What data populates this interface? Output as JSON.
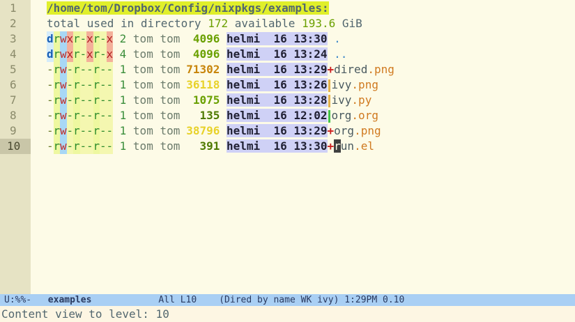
{
  "header": {
    "path": "/home/tom/Dropbox/Config/nixpkgs/examples:",
    "total_prefix": "total used in directory ",
    "total_used": "172",
    "available_label": " available ",
    "available_value": "193.6",
    "available_unit": " GiB"
  },
  "line_numbers": [
    "1",
    "2",
    "3",
    "4",
    "5",
    "6",
    "7",
    "8",
    "9",
    "10"
  ],
  "entries": [
    {
      "perms": [
        "d",
        "r",
        "w",
        "x",
        "r",
        "-",
        "x",
        "r",
        "-",
        "x"
      ],
      "links": "2",
      "owner": "tom tom",
      "size": "4096",
      "size_color": "#6aa000",
      "user": "helmi",
      "day": "16",
      "time": "13:30",
      "mark": "",
      "name": ".",
      "ext": ""
    },
    {
      "perms": [
        "d",
        "r",
        "w",
        "x",
        "r",
        "-",
        "x",
        "r",
        "-",
        "x"
      ],
      "links": "4",
      "owner": "tom tom",
      "size": "4096",
      "size_color": "#6aa000",
      "user": "helmi",
      "day": "16",
      "time": "13:24",
      "mark": "",
      "name": "..",
      "ext": ""
    },
    {
      "perms": [
        "-",
        "r",
        "w",
        "-",
        "r",
        "-",
        "-",
        "r",
        "-",
        "-"
      ],
      "links": "1",
      "owner": "tom tom",
      "size": "71302",
      "size_color": "#c8850a",
      "user": "helmi",
      "day": "16",
      "time": "13:29",
      "mark": "+",
      "name": "dired",
      "ext": ".png"
    },
    {
      "perms": [
        "-",
        "r",
        "w",
        "-",
        "r",
        "-",
        "-",
        "r",
        "-",
        "-"
      ],
      "links": "1",
      "owner": "tom tom",
      "size": "36118",
      "size_color": "#e8d22a",
      "user": "helmi",
      "day": "16",
      "time": "13:26",
      "mark": "|y",
      "name": "ivy",
      "ext": ".png"
    },
    {
      "perms": [
        "-",
        "r",
        "w",
        "-",
        "r",
        "-",
        "-",
        "r",
        "-",
        "-"
      ],
      "links": "1",
      "owner": "tom tom",
      "size": "1075",
      "size_color": "#6aa000",
      "user": "helmi",
      "day": "16",
      "time": "13:28",
      "mark": "|y",
      "name": "ivy",
      "ext": ".py"
    },
    {
      "perms": [
        "-",
        "r",
        "w",
        "-",
        "r",
        "-",
        "-",
        "r",
        "-",
        "-"
      ],
      "links": "1",
      "owner": "tom tom",
      "size": "135",
      "size_color": "#4e7a00",
      "user": "helmi",
      "day": "16",
      "time": "12:02",
      "mark": "|g",
      "name": "org",
      "ext": ".org"
    },
    {
      "perms": [
        "-",
        "r",
        "w",
        "-",
        "r",
        "-",
        "-",
        "r",
        "-",
        "-"
      ],
      "links": "1",
      "owner": "tom tom",
      "size": "38796",
      "size_color": "#e8d22a",
      "user": "helmi",
      "day": "16",
      "time": "13:29",
      "mark": "+",
      "name": "org",
      "ext": ".png"
    },
    {
      "perms": [
        "-",
        "r",
        "w",
        "-",
        "r",
        "-",
        "-",
        "r",
        "-",
        "-"
      ],
      "links": "1",
      "owner": "tom tom",
      "size": "391",
      "size_color": "#4e7a00",
      "user": "helmi",
      "day": "16",
      "time": "13:30",
      "mark": "+",
      "name": "run",
      "ext": ".el",
      "cursor": true
    }
  ],
  "modeline": {
    "state": "U:%%-",
    "buffer": "examples",
    "position": "All L10",
    "modes": "(Dired by name WK ivy)",
    "time": "1:29PM",
    "load": "0.10"
  },
  "minibuffer": {
    "message": "Content view to level: 10"
  }
}
